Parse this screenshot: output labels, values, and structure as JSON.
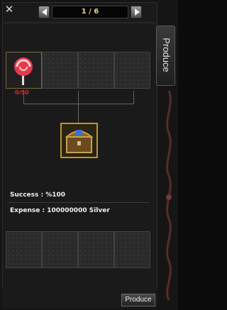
{
  "window": {
    "close_icon": "close-icon",
    "page_indicator": "1 / 6",
    "tab_label": "Produce"
  },
  "materials": {
    "slots": [
      {
        "item": "lollipop",
        "count": "0/50"
      },
      {
        "item": "",
        "count": ""
      },
      {
        "item": "",
        "count": ""
      },
      {
        "item": "",
        "count": ""
      }
    ]
  },
  "product": {
    "item": "treasure-chest"
  },
  "info": {
    "success": "Success : %100",
    "expense": "Expense : 100000000 Silver"
  },
  "output_slots": [
    "",
    "",
    "",
    ""
  ],
  "buttons": {
    "produce": "Produce"
  },
  "colors": {
    "count_red": "#d62a2a",
    "gold_border": "#b8953a"
  }
}
